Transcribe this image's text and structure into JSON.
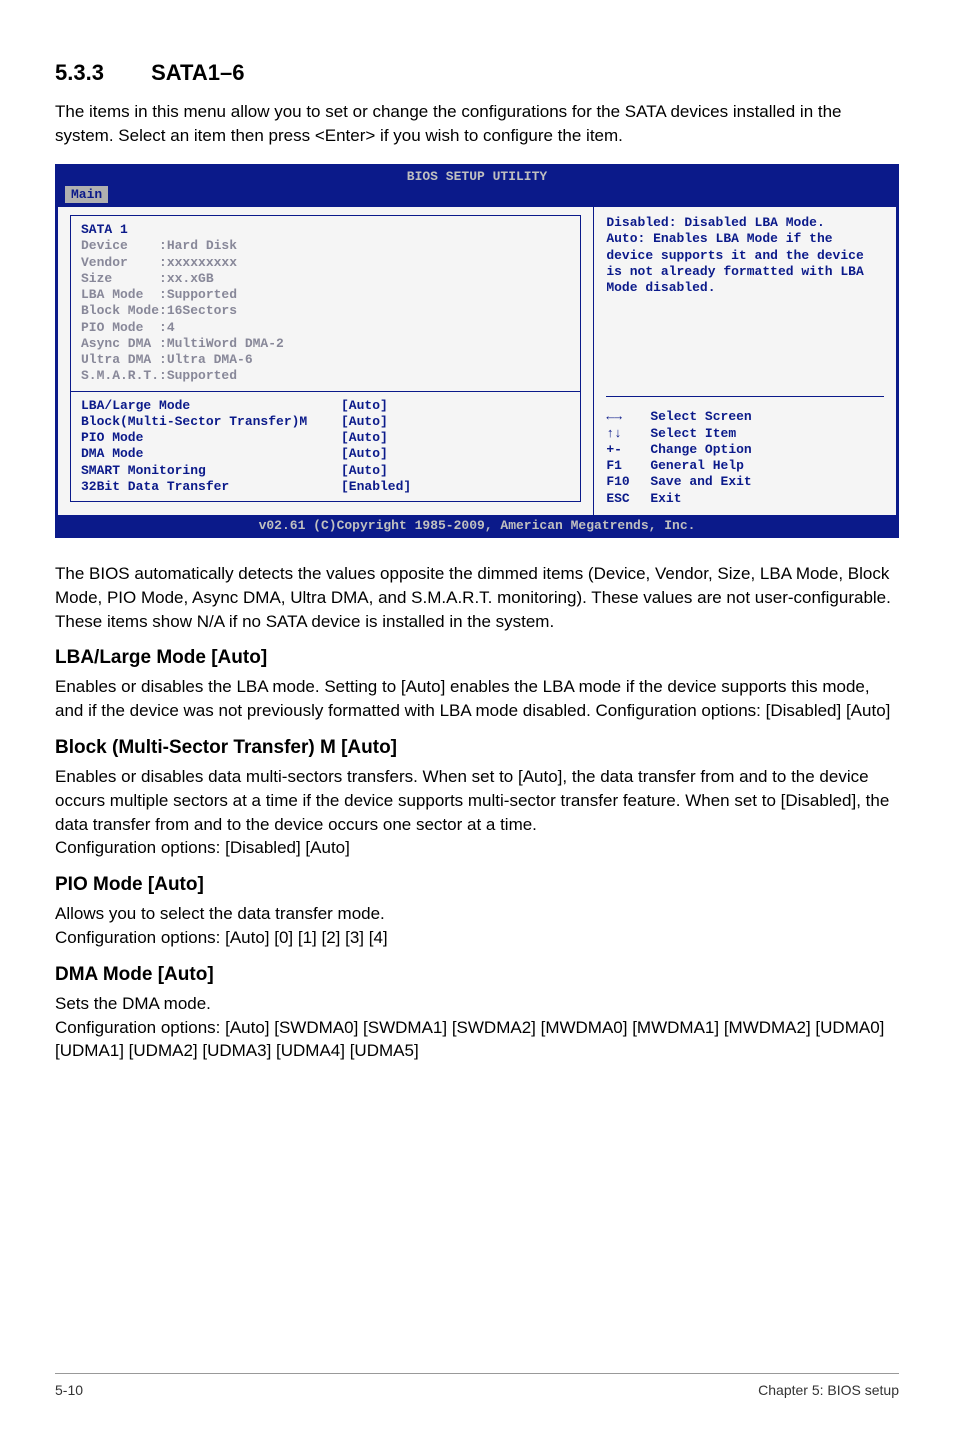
{
  "section": {
    "number": "5.3.3",
    "title": "SATA1–6"
  },
  "intro": "The items in this menu allow you to set or change the configurations for the SATA devices installed in the system. Select an item then press <Enter> if you wish to configure the item.",
  "bios": {
    "title": "BIOS SETUP UTILITY",
    "tab": "Main",
    "header": "SATA 1",
    "info_rows": [
      {
        "label": "Device",
        "value": ":Hard Disk"
      },
      {
        "label": "Vendor",
        "value": ":xxxxxxxxx"
      },
      {
        "label": "Size",
        "value": ":xx.xGB"
      },
      {
        "label": "LBA Mode",
        "value": ":Supported"
      },
      {
        "label": "Block Mode:16Sectors",
        "value": ""
      },
      {
        "label": "PIO Mode",
        "value": ":4"
      },
      {
        "label": "Async DMA :MultiWord DMA-2",
        "value": ""
      },
      {
        "label": "Ultra DMA :Ultra DMA-6",
        "value": ""
      },
      {
        "label": "S.M.A.R.T.:Supported",
        "value": ""
      }
    ],
    "options": [
      {
        "label": "LBA/Large Mode",
        "value": "[Auto]"
      },
      {
        "label": "Block(Multi-Sector Transfer)M",
        "value": "[Auto]"
      },
      {
        "label": "PIO Mode",
        "value": "[Auto]"
      },
      {
        "label": "DMA Mode",
        "value": "[Auto]"
      },
      {
        "label": "SMART Monitoring",
        "value": "[Auto]"
      },
      {
        "label": "32Bit Data Transfer",
        "value": "[Enabled]"
      }
    ],
    "help_text": "Disabled: Disabled LBA Mode.\nAuto: Enables LBA Mode if the device supports it and the device is not already formatted with LBA Mode disabled.",
    "nav_keys": [
      {
        "key": "←→",
        "action": "Select Screen"
      },
      {
        "key": "↑↓",
        "action": "Select Item"
      },
      {
        "key": "+-",
        "action": "Change Option"
      },
      {
        "key": "F1",
        "action": "General Help"
      },
      {
        "key": "F10",
        "action": "Save and Exit"
      },
      {
        "key": "ESC",
        "action": "Exit"
      }
    ],
    "footer": "v02.61 (C)Copyright 1985-2009, American Megatrends, Inc."
  },
  "post_bios": "The BIOS automatically detects the values opposite the dimmed items (Device, Vendor, Size, LBA Mode, Block Mode, PIO Mode, Async DMA, Ultra DMA, and S.M.A.R.T. monitoring). These values are not user-configurable. These items show N/A if no SATA device is installed in the system.",
  "subsections": [
    {
      "title": "LBA/Large Mode [Auto]",
      "text": "Enables or disables the LBA mode. Setting to [Auto] enables the LBA mode if the device supports this mode, and if the device was not previously formatted with LBA mode disabled. Configuration options: [Disabled] [Auto]"
    },
    {
      "title": "Block (Multi-Sector Transfer) M [Auto]",
      "text": "Enables or disables data multi-sectors transfers. When set to [Auto], the data transfer from and to the device occurs multiple sectors at a time if the device supports multi-sector transfer feature. When set to [Disabled], the data transfer from and to the device occurs one sector at a time.\nConfiguration options: [Disabled] [Auto]"
    },
    {
      "title": "PIO Mode [Auto]",
      "text": "Allows you to select the data transfer mode.\nConfiguration options: [Auto] [0] [1] [2] [3] [4]"
    },
    {
      "title": "DMA Mode [Auto]",
      "text": "Sets the DMA mode.\nConfiguration options: [Auto] [SWDMA0] [SWDMA1] [SWDMA2] [MWDMA0] [MWDMA1] [MWDMA2] [UDMA0] [UDMA1] [UDMA2] [UDMA3] [UDMA4] [UDMA5]"
    }
  ],
  "footer": {
    "left": "5-10",
    "right": "Chapter 5: BIOS setup"
  }
}
